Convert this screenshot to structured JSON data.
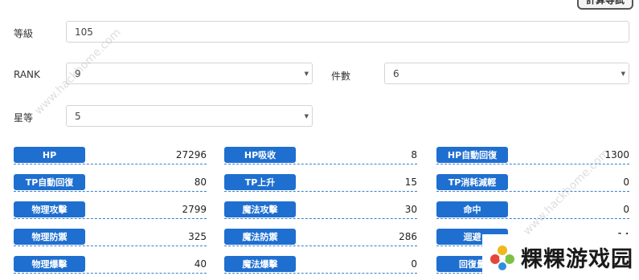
{
  "calculate_button": "計算等試",
  "fields": {
    "level": {
      "label": "等級",
      "value": "105"
    },
    "rank": {
      "label": "RANK",
      "value": "9"
    },
    "pieces": {
      "label": "件數",
      "value": "6"
    },
    "stars": {
      "label": "星等",
      "value": "5"
    }
  },
  "stats": [
    {
      "label": "HP",
      "value": "27296"
    },
    {
      "label": "HP吸收",
      "value": "8"
    },
    {
      "label": "HP自動回復",
      "value": "1300"
    },
    {
      "label": "TP自動回復",
      "value": "80"
    },
    {
      "label": "TP上升",
      "value": "15"
    },
    {
      "label": "TP消耗減輕",
      "value": "0"
    },
    {
      "label": "物理攻擊",
      "value": "2799"
    },
    {
      "label": "魔法攻擊",
      "value": "30"
    },
    {
      "label": "命中",
      "value": "0"
    },
    {
      "label": "物理防禦",
      "value": "325"
    },
    {
      "label": "魔法防禦",
      "value": "286"
    },
    {
      "label": "迴避",
      "value": "14"
    },
    {
      "label": "物理爆擊",
      "value": "40"
    },
    {
      "label": "魔法爆擊",
      "value": "0"
    },
    {
      "label": "回復量",
      "value": ""
    }
  ],
  "watermark": {
    "text": "www.hackhome.com"
  },
  "brand": {
    "name": "粿粿游戏园",
    "accent_colors": [
      "#f0b81c",
      "#e8443a",
      "#7cc242",
      "#2f8fde"
    ]
  },
  "colors": {
    "badge": "#1f6fd0",
    "underline": "#3c7fc8"
  }
}
